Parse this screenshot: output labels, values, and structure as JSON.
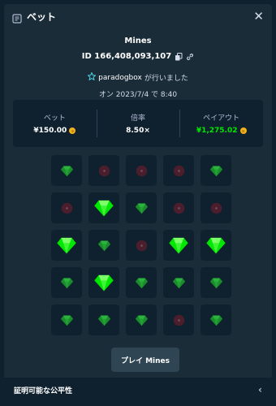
{
  "modal": {
    "title": "ベット",
    "title_icon": "receipt-icon",
    "close_icon": "close-icon"
  },
  "bet": {
    "game": "Mines",
    "id": "ID 166,408,093,107",
    "copy_icon": "copy-icon",
    "link_icon": "link-icon",
    "user_icon": "star-badge-icon",
    "username": "paradogbox",
    "placed_by_suffix": "が行いました",
    "date": "オン 2023/7/4 で 8:40"
  },
  "stats": {
    "bet_label": "ベット",
    "bet_value": "¥150.00",
    "multiplier_label": "倍率",
    "multiplier_value": "8.50×",
    "payout_label": "ペイアウト",
    "payout_value": "¥1,275.02",
    "currency_icon": "coin-icon"
  },
  "board": {
    "rows": 5,
    "cols": 5,
    "tiles": [
      "gem",
      "mine",
      "mine",
      "mine",
      "gem",
      "mine",
      "gem-revealed",
      "gem",
      "mine",
      "mine",
      "gem-revealed",
      "gem",
      "mine",
      "gem-revealed",
      "gem-revealed",
      "gem",
      "gem-revealed",
      "gem",
      "gem",
      "gem",
      "gem",
      "gem",
      "gem",
      "mine",
      "gem"
    ]
  },
  "actions": {
    "play_label": "プレイ Mines"
  },
  "footer": {
    "fairness_label": "証明可能な公平性",
    "chevron_icon": "chevron-left-icon"
  },
  "colors": {
    "background": "#1a2c38",
    "panel": "#0f212e",
    "button": "#2f4553",
    "payout_green": "#00e701",
    "gem_bright": "#00e701",
    "gem_dim": "#1b8c2c",
    "mine_dim": "#4a1e2c",
    "coin": "#f1b11b"
  }
}
